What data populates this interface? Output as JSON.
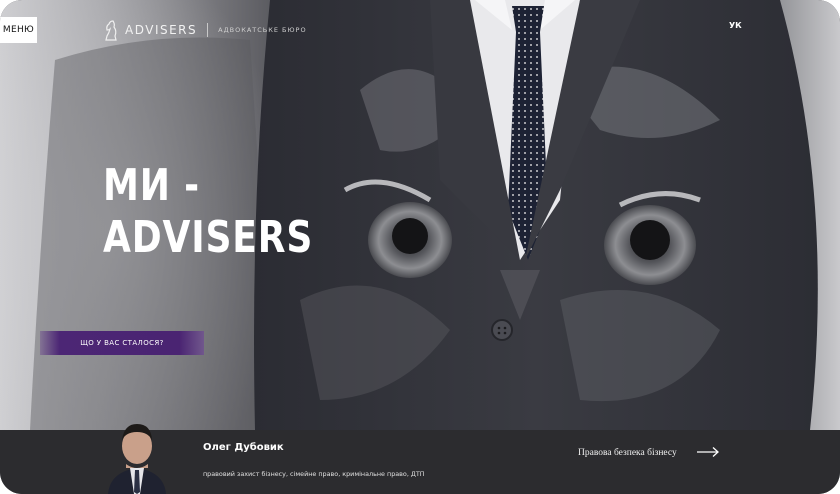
{
  "header": {
    "menu_label": "МЕНЮ",
    "logo_text": "ADVISERS",
    "logo_subtitle": "Адвокатське бюро",
    "language": "УК"
  },
  "hero": {
    "title_line1": "МИ -",
    "title_line2": "ADVISERS",
    "cta_label": "Що у вас сталося?"
  },
  "lawyer": {
    "name": "Олег Дубовик",
    "specialization": "правовий захист бізнесу, сімейне право, кримінальне право, ДТП"
  },
  "service": {
    "label": "Правова безпека бізнесу"
  },
  "colors": {
    "accent_purple": "#4a2472",
    "strip_bg": "#2c2c2f",
    "text_white": "#ffffff"
  },
  "icons": {
    "logo": "knight-logo-icon",
    "arrow": "arrow-right-icon"
  }
}
